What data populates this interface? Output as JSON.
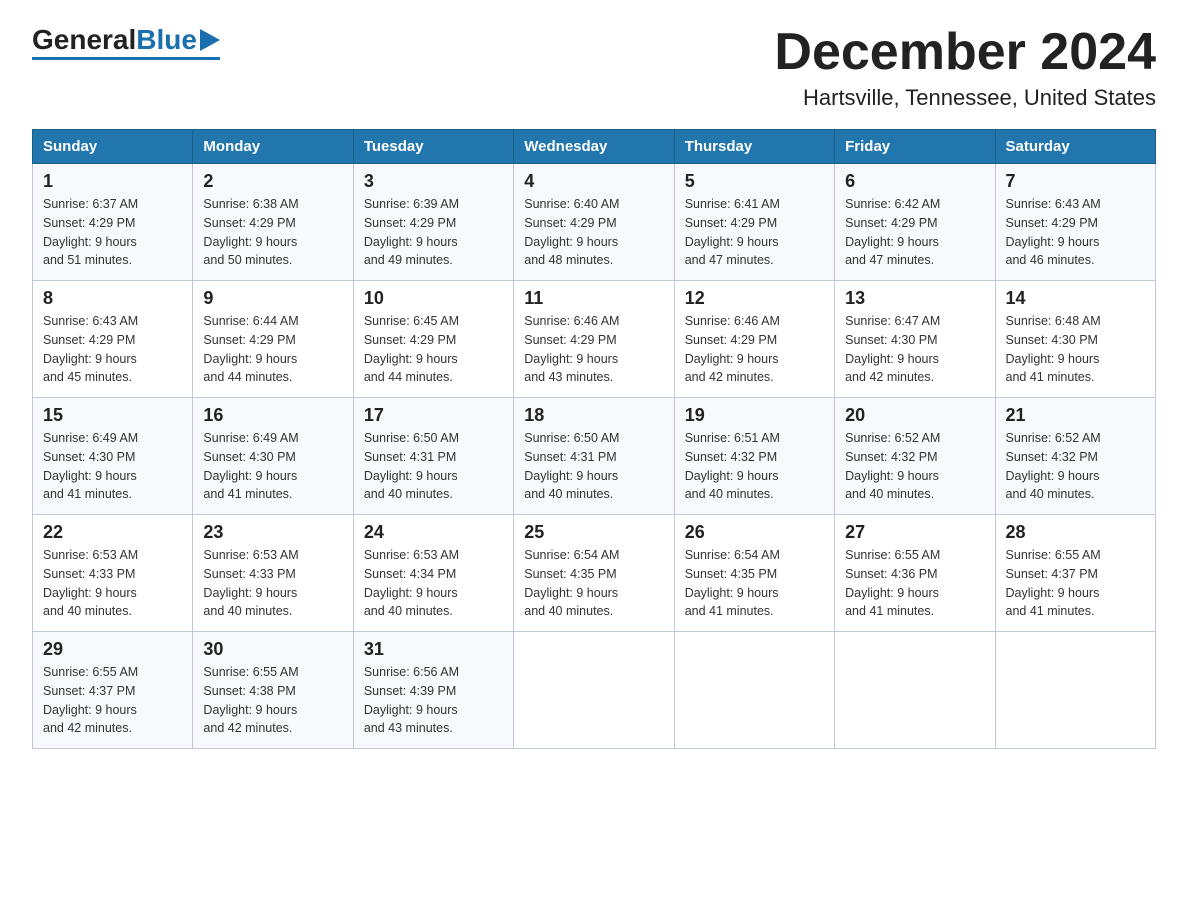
{
  "header": {
    "logo_general": "General",
    "logo_blue": "Blue",
    "title": "December 2024",
    "subtitle": "Hartsville, Tennessee, United States"
  },
  "weekdays": [
    "Sunday",
    "Monday",
    "Tuesday",
    "Wednesday",
    "Thursday",
    "Friday",
    "Saturday"
  ],
  "weeks": [
    [
      {
        "day": "1",
        "sunrise": "6:37 AM",
        "sunset": "4:29 PM",
        "daylight": "9 hours and 51 minutes."
      },
      {
        "day": "2",
        "sunrise": "6:38 AM",
        "sunset": "4:29 PM",
        "daylight": "9 hours and 50 minutes."
      },
      {
        "day": "3",
        "sunrise": "6:39 AM",
        "sunset": "4:29 PM",
        "daylight": "9 hours and 49 minutes."
      },
      {
        "day": "4",
        "sunrise": "6:40 AM",
        "sunset": "4:29 PM",
        "daylight": "9 hours and 48 minutes."
      },
      {
        "day": "5",
        "sunrise": "6:41 AM",
        "sunset": "4:29 PM",
        "daylight": "9 hours and 47 minutes."
      },
      {
        "day": "6",
        "sunrise": "6:42 AM",
        "sunset": "4:29 PM",
        "daylight": "9 hours and 47 minutes."
      },
      {
        "day": "7",
        "sunrise": "6:43 AM",
        "sunset": "4:29 PM",
        "daylight": "9 hours and 46 minutes."
      }
    ],
    [
      {
        "day": "8",
        "sunrise": "6:43 AM",
        "sunset": "4:29 PM",
        "daylight": "9 hours and 45 minutes."
      },
      {
        "day": "9",
        "sunrise": "6:44 AM",
        "sunset": "4:29 PM",
        "daylight": "9 hours and 44 minutes."
      },
      {
        "day": "10",
        "sunrise": "6:45 AM",
        "sunset": "4:29 PM",
        "daylight": "9 hours and 44 minutes."
      },
      {
        "day": "11",
        "sunrise": "6:46 AM",
        "sunset": "4:29 PM",
        "daylight": "9 hours and 43 minutes."
      },
      {
        "day": "12",
        "sunrise": "6:46 AM",
        "sunset": "4:29 PM",
        "daylight": "9 hours and 42 minutes."
      },
      {
        "day": "13",
        "sunrise": "6:47 AM",
        "sunset": "4:30 PM",
        "daylight": "9 hours and 42 minutes."
      },
      {
        "day": "14",
        "sunrise": "6:48 AM",
        "sunset": "4:30 PM",
        "daylight": "9 hours and 41 minutes."
      }
    ],
    [
      {
        "day": "15",
        "sunrise": "6:49 AM",
        "sunset": "4:30 PM",
        "daylight": "9 hours and 41 minutes."
      },
      {
        "day": "16",
        "sunrise": "6:49 AM",
        "sunset": "4:30 PM",
        "daylight": "9 hours and 41 minutes."
      },
      {
        "day": "17",
        "sunrise": "6:50 AM",
        "sunset": "4:31 PM",
        "daylight": "9 hours and 40 minutes."
      },
      {
        "day": "18",
        "sunrise": "6:50 AM",
        "sunset": "4:31 PM",
        "daylight": "9 hours and 40 minutes."
      },
      {
        "day": "19",
        "sunrise": "6:51 AM",
        "sunset": "4:32 PM",
        "daylight": "9 hours and 40 minutes."
      },
      {
        "day": "20",
        "sunrise": "6:52 AM",
        "sunset": "4:32 PM",
        "daylight": "9 hours and 40 minutes."
      },
      {
        "day": "21",
        "sunrise": "6:52 AM",
        "sunset": "4:32 PM",
        "daylight": "9 hours and 40 minutes."
      }
    ],
    [
      {
        "day": "22",
        "sunrise": "6:53 AM",
        "sunset": "4:33 PM",
        "daylight": "9 hours and 40 minutes."
      },
      {
        "day": "23",
        "sunrise": "6:53 AM",
        "sunset": "4:33 PM",
        "daylight": "9 hours and 40 minutes."
      },
      {
        "day": "24",
        "sunrise": "6:53 AM",
        "sunset": "4:34 PM",
        "daylight": "9 hours and 40 minutes."
      },
      {
        "day": "25",
        "sunrise": "6:54 AM",
        "sunset": "4:35 PM",
        "daylight": "9 hours and 40 minutes."
      },
      {
        "day": "26",
        "sunrise": "6:54 AM",
        "sunset": "4:35 PM",
        "daylight": "9 hours and 41 minutes."
      },
      {
        "day": "27",
        "sunrise": "6:55 AM",
        "sunset": "4:36 PM",
        "daylight": "9 hours and 41 minutes."
      },
      {
        "day": "28",
        "sunrise": "6:55 AM",
        "sunset": "4:37 PM",
        "daylight": "9 hours and 41 minutes."
      }
    ],
    [
      {
        "day": "29",
        "sunrise": "6:55 AM",
        "sunset": "4:37 PM",
        "daylight": "9 hours and 42 minutes."
      },
      {
        "day": "30",
        "sunrise": "6:55 AM",
        "sunset": "4:38 PM",
        "daylight": "9 hours and 42 minutes."
      },
      {
        "day": "31",
        "sunrise": "6:56 AM",
        "sunset": "4:39 PM",
        "daylight": "9 hours and 43 minutes."
      },
      null,
      null,
      null,
      null
    ]
  ],
  "labels": {
    "sunrise": "Sunrise:",
    "sunset": "Sunset:",
    "daylight": "Daylight:"
  }
}
